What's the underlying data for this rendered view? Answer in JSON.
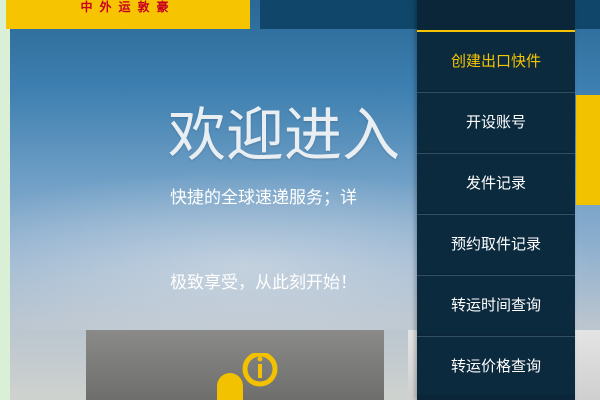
{
  "logo": {
    "text": "中外运敦豪",
    "bg_color": "#f6c400",
    "text_color": "#c8001e"
  },
  "hero": {
    "title": "欢迎进入",
    "tagline": "快捷的全球速递服务；详",
    "slogan": "极致享受，从此刻开始！"
  },
  "menu": {
    "items": [
      {
        "label": "创建出口快件",
        "active": true
      },
      {
        "label": "开设账号",
        "active": false
      },
      {
        "label": "发件记录",
        "active": false
      },
      {
        "label": "预约取件记录",
        "active": false
      },
      {
        "label": "转运时间查询",
        "active": false
      },
      {
        "label": "转运价格查询",
        "active": false
      }
    ],
    "active_color": "#f6c400",
    "bg_color": "#0a2638"
  },
  "icons": {
    "info": "info-person-icon"
  }
}
